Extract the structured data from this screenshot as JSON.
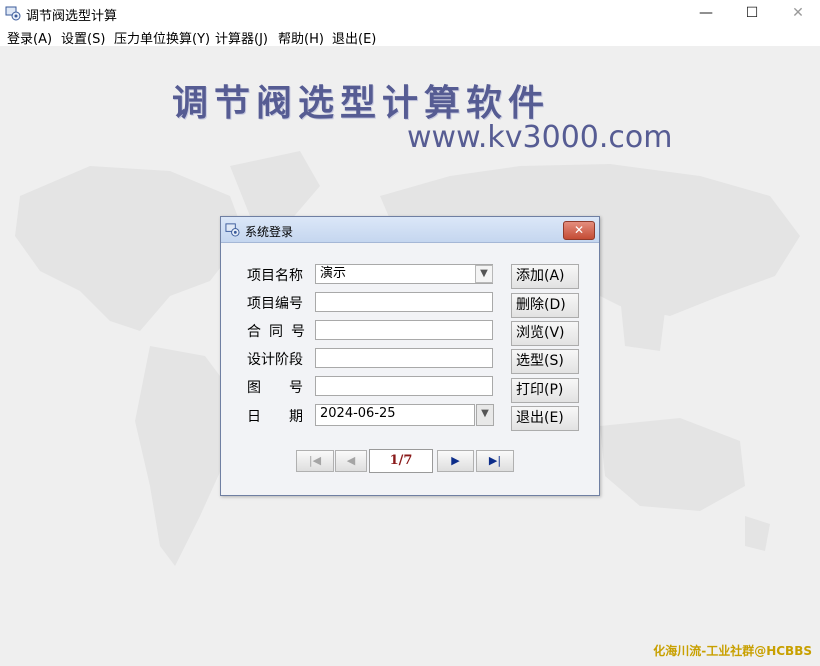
{
  "window": {
    "title": "调节阀选型计算",
    "controls": {
      "minimize": "—",
      "maximize": "☐",
      "close": "✕"
    }
  },
  "menu": [
    {
      "label": "登录(A)"
    },
    {
      "label": "设置(S)"
    },
    {
      "label": "压力单位换算(Y)"
    },
    {
      "label": "计算器(J)"
    },
    {
      "label": "帮助(H)"
    },
    {
      "label": "退出(E)"
    }
  ],
  "banner": {
    "title": "调节阀选型计算软件",
    "url": "www.kv3000.com"
  },
  "dialog": {
    "title": "系统登录",
    "close_symbol": "✕",
    "fields": {
      "project_name": {
        "label": "项目名称",
        "value": "演示"
      },
      "project_no": {
        "label": "项目编号",
        "value": ""
      },
      "contract_no": {
        "label": "合同号",
        "value": ""
      },
      "design_stage": {
        "label": "设计阶段",
        "value": ""
      },
      "drawing_no": {
        "label": "图号",
        "value": ""
      },
      "date": {
        "label": "日期",
        "value": "2024-06-25"
      }
    },
    "buttons": {
      "add": "添加(A)",
      "delete": "删除(D)",
      "browse": "浏览(V)",
      "select": "选型(S)",
      "print": "打印(P)",
      "exit": "退出(E)"
    },
    "nav": {
      "first": "|◀",
      "prev": "◀",
      "page": "1/7",
      "next": "▶",
      "last": "▶|"
    }
  },
  "watermark": "化海川流-工业社群@HCBBS",
  "colors": {
    "banner": "#565c93",
    "watermark": "#c8a000",
    "page_indicator": "#8a1a1a"
  },
  "icons": {
    "app": "app-icon",
    "combo": "chevron-down-icon"
  }
}
